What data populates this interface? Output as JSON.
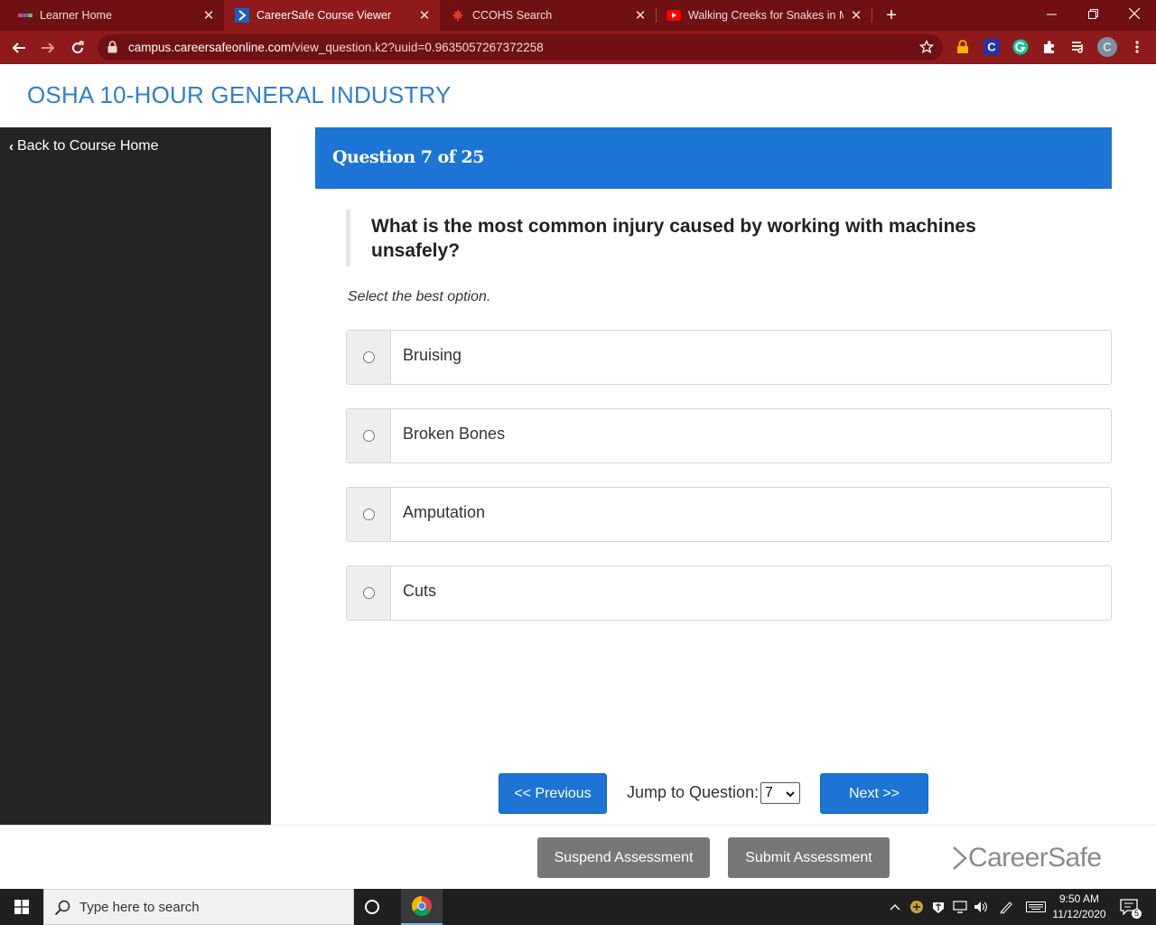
{
  "browser": {
    "tabs": [
      {
        "title": "Learner Home",
        "active": false
      },
      {
        "title": "CareerSafe Course Viewer",
        "active": true
      },
      {
        "title": "CCOHS Search",
        "active": false
      },
      {
        "title": "Walking Creeks for Snakes in Me",
        "active": false
      }
    ],
    "url_host": "campus.careersafeonline.com",
    "url_path": "/view_question.k2?uuid=0.9635057267372258",
    "profile_initial": "C",
    "extension_initial": "C"
  },
  "page": {
    "site_title": "OSHA 10-HOUR GENERAL INDUSTRY",
    "back_link": "Back to Course Home",
    "question_number": "Question 7 of 25",
    "question_text": "What is the most common injury caused by working with machines unsafely?",
    "instruction": "Select the best option.",
    "options": [
      {
        "label": "Bruising"
      },
      {
        "label": "Broken Bones"
      },
      {
        "label": "Amputation"
      },
      {
        "label": "Cuts"
      }
    ],
    "previous_label": "<< Previous",
    "next_label": "Next >>",
    "jump_label": "Jump to Question:",
    "jump_value": "7",
    "suspend_label": "Suspend Assessment",
    "submit_label": "Submit Assessment",
    "brand_name": "CareerSafe",
    "colors": {
      "primary_blue": "#1c74d4",
      "title_blue": "#2f7fd0",
      "sidebar": "#242424",
      "chrome_red": "#8f1a1c"
    }
  },
  "taskbar": {
    "search_placeholder": "Type here to search",
    "time": "9:50 AM",
    "date": "11/12/2020",
    "notification_count": "5"
  }
}
